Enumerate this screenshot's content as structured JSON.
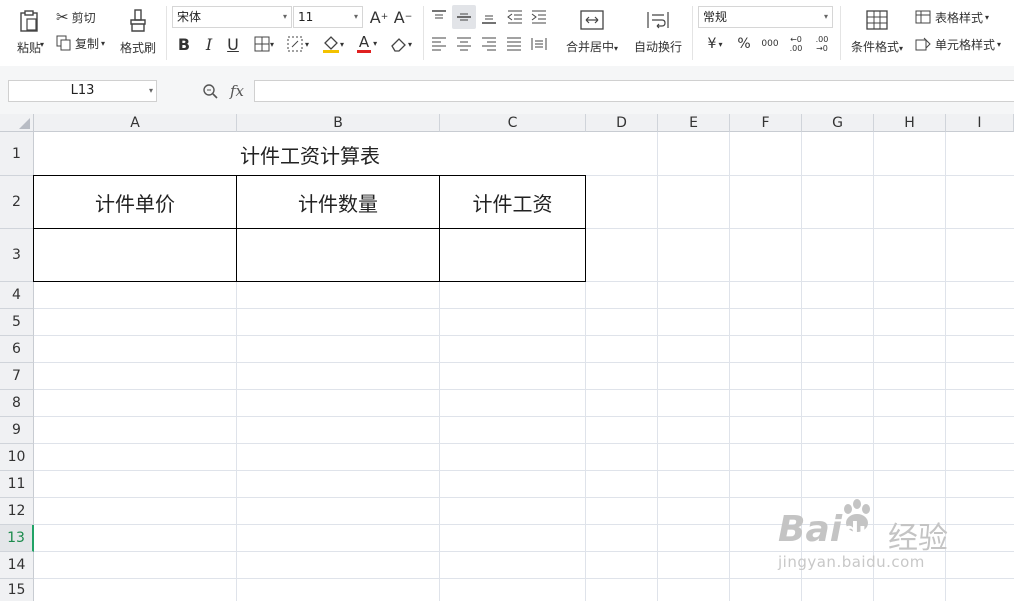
{
  "toolbar": {
    "paste": "粘贴",
    "cut": "剪切",
    "copy": "复制",
    "format_painter": "格式刷",
    "font_name": "宋体",
    "font_size": "11",
    "merge_center": "合并居中",
    "wrap_text": "自动换行",
    "number_format": "常规",
    "currency_symbol": "¥",
    "percent_symbol": "%",
    "thousands_symbol": "000",
    "increase_decimal": "←0 .00",
    "decrease_decimal": ".00 →0",
    "conditional_format": "条件格式",
    "table_style": "表格样式",
    "cell_style": "单元格样式",
    "bold": "B",
    "italic": "I",
    "underline": "U"
  },
  "formula_bar": {
    "name_box": "L13",
    "fx": "fx",
    "value": ""
  },
  "sheet": {
    "columns": [
      "A",
      "B",
      "C",
      "D",
      "E",
      "F",
      "G",
      "H",
      "I"
    ],
    "rows": [
      "1",
      "2",
      "3",
      "4",
      "5",
      "6",
      "7",
      "8",
      "9",
      "10",
      "11",
      "12",
      "13",
      "14",
      "15"
    ],
    "active_row": "13",
    "title": "计件工资计算表",
    "headers": [
      "计件单价",
      "计件数量",
      "计件工资"
    ]
  },
  "watermark": {
    "brand": "Bai",
    "brand2": "du",
    "jingyan": "经验",
    "url": "jingyan.baidu.com"
  }
}
